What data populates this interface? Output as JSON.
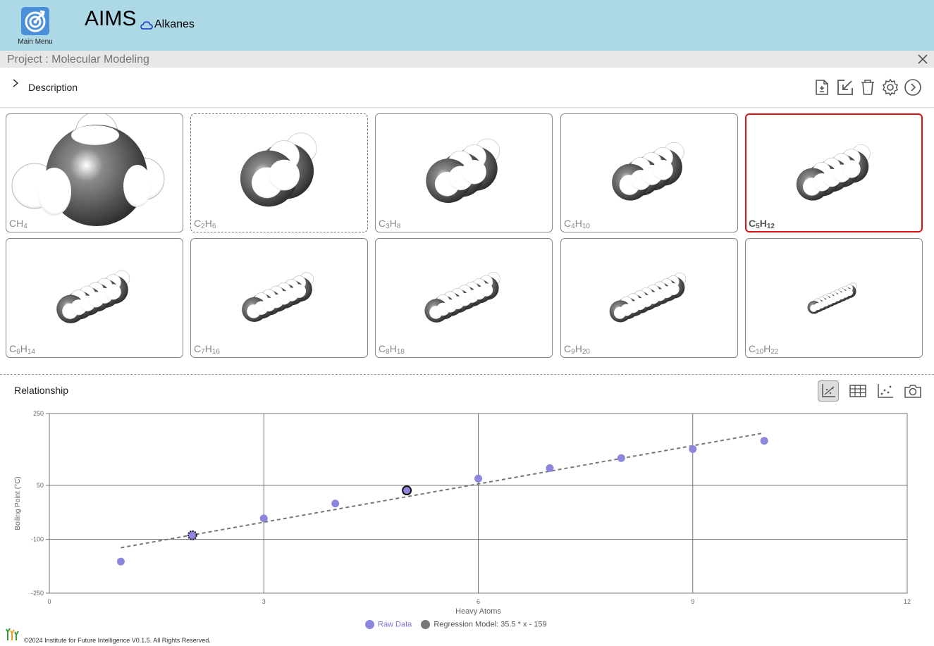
{
  "header": {
    "app_title": "AIMS",
    "subtitle": "Alkanes",
    "menu_label": "Main Menu",
    "bg_color": "#add8e6"
  },
  "project": {
    "title": "Project : Molecular Modeling"
  },
  "description": {
    "label": "Description"
  },
  "toolbar": {
    "icons": [
      "document-plus-icon",
      "import-icon",
      "trash-icon",
      "gear-icon",
      "play-circle-icon"
    ]
  },
  "molecules": [
    {
      "formula_main": "CH",
      "formula_sub": "4"
    },
    {
      "formula_main": "C",
      "formula_sub": "2",
      "formula_main2": "H",
      "formula_sub2": "6"
    },
    {
      "formula_main": "C",
      "formula_sub": "3",
      "formula_main2": "H",
      "formula_sub2": "8"
    },
    {
      "formula_main": "C",
      "formula_sub": "4",
      "formula_main2": "H",
      "formula_sub2": "10"
    },
    {
      "formula_main": "C",
      "formula_sub": "5",
      "formula_main2": "H",
      "formula_sub2": "12",
      "selected": true
    },
    {
      "formula_main": "C",
      "formula_sub": "6",
      "formula_main2": "H",
      "formula_sub2": "14"
    },
    {
      "formula_main": "C",
      "formula_sub": "7",
      "formula_main2": "H",
      "formula_sub2": "16"
    },
    {
      "formula_main": "C",
      "formula_sub": "8",
      "formula_main2": "H",
      "formula_sub2": "18"
    },
    {
      "formula_main": "C",
      "formula_sub": "9",
      "formula_main2": "H",
      "formula_sub2": "20"
    },
    {
      "formula_main": "C",
      "formula_sub": "10",
      "formula_main2": "H",
      "formula_sub2": "22"
    }
  ],
  "relationship": {
    "title": "Relationship",
    "tools": [
      "line-chart-icon",
      "table-icon",
      "scatter-icon",
      "camera-icon"
    ]
  },
  "chart_data": {
    "type": "scatter",
    "xlabel": "Heavy Atoms",
    "ylabel": "Boiling Point (°C)",
    "xlim": [
      0,
      12
    ],
    "ylim": [
      -250,
      250
    ],
    "x_ticks": [
      0,
      3,
      6,
      9,
      12
    ],
    "y_ticks": [
      250,
      50,
      -100,
      -250
    ],
    "grid": true,
    "series": [
      {
        "name": "Raw Data",
        "color": "#8d86dd",
        "x": [
          1,
          2,
          3,
          4,
          5,
          6,
          7,
          8,
          9,
          10
        ],
        "y": [
          -162,
          -89,
          -42,
          -0.5,
          36,
          69,
          98,
          126,
          151,
          174
        ]
      },
      {
        "name": "Regression Model: 35.5 * x - 159",
        "color": "#777777",
        "type": "line",
        "slope": 35.5,
        "intercept": -159,
        "x_range": [
          1,
          10
        ]
      }
    ],
    "highlighted_x": [
      2,
      5
    ]
  },
  "footer": {
    "text": "©2024 Institute for Future Intelligence V0.1.5. All Rights Reserved."
  }
}
